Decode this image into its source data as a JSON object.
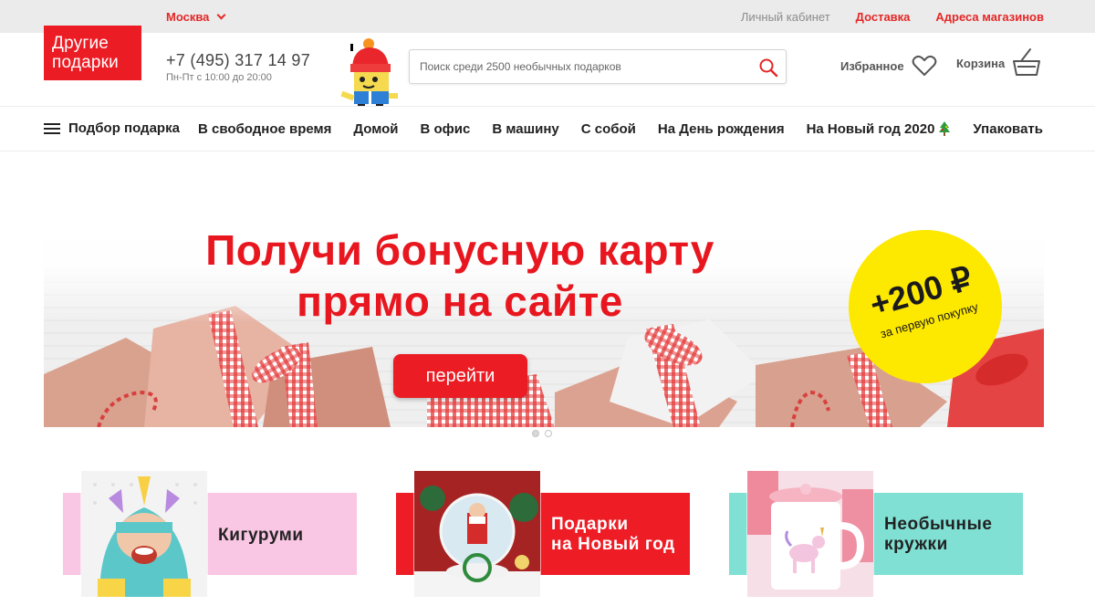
{
  "topbar": {
    "city": "Москва",
    "links": [
      "Личный кабинет",
      "Доставка",
      "Адреса магазинов"
    ]
  },
  "header": {
    "logo_line1": "Другие",
    "logo_line2": "подарки",
    "phone": "+7 (495) 317 14 97",
    "hours": "Пн-Пт с 10:00 до 20:00",
    "search_placeholder": "Поиск среди 2500 необычных подарков",
    "favorites_label": "Избранное",
    "cart_label": "Корзина"
  },
  "nav": {
    "picker_label": "Подбор подарка",
    "links": [
      "В свободное время",
      "Домой",
      "В офис",
      "В машину",
      "С собой",
      "На День рождения",
      "На Новый год 2020",
      "Упаковать"
    ]
  },
  "banner": {
    "headline_line1": "Получи бонусную карту",
    "headline_line2": "прямо на сайте",
    "cta_label": "перейти",
    "bonus_amount": "+200 ₽",
    "bonus_caption": "за первую покупку",
    "slides_total": 2,
    "active_slide": 1
  },
  "categories": [
    {
      "label_line1": "Кигуруми",
      "label_line2": "",
      "band_color": "#f9c6e4",
      "text_color": "#222222"
    },
    {
      "label_line1": "Подарки",
      "label_line2": "на Новый год",
      "band_color": "#ee1c25",
      "text_color": "#ffffff"
    },
    {
      "label_line1": "Необычные",
      "label_line2": "кружки",
      "band_color": "#7fe0d3",
      "text_color": "#222222"
    }
  ],
  "colors": {
    "brand_red": "#ec1c24",
    "bonus_yellow": "#fde800",
    "topbar_bg": "#ebebeb"
  }
}
